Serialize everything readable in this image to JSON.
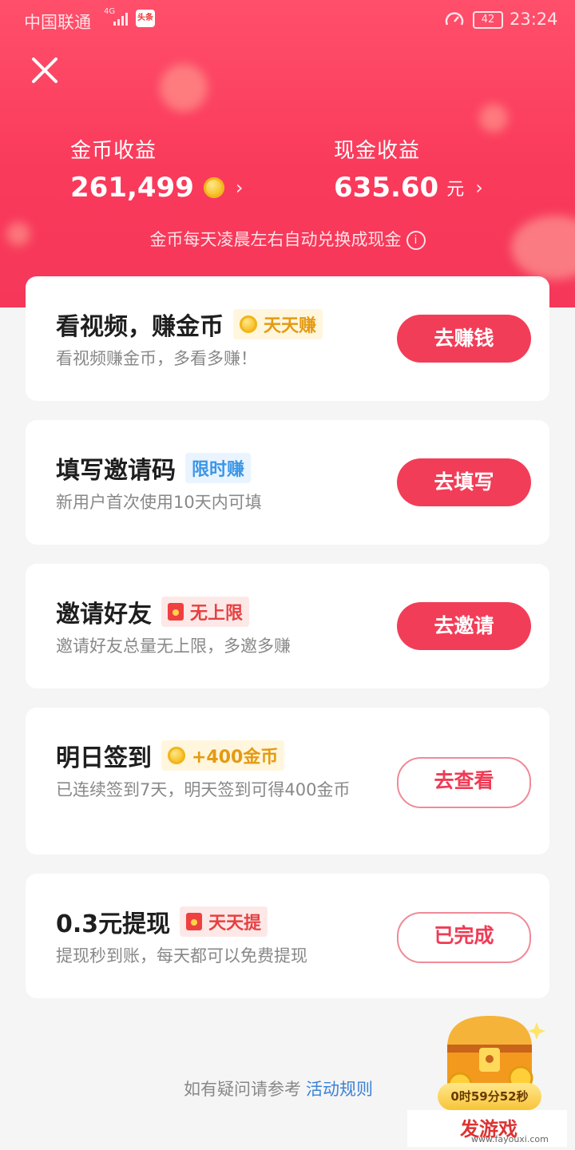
{
  "status_bar": {
    "carrier": "中国联通",
    "network": "4G",
    "battery": "42",
    "time": "23:24",
    "news_app_icon": "头条"
  },
  "header": {
    "coin_label": "金币收益",
    "coin_value": "261,499",
    "cash_label": "现金收益",
    "cash_value": "635.60",
    "cash_unit": "元",
    "chevron": "›",
    "note": "金币每天凌晨左右自动兑换成现金",
    "info": "i",
    "close_icon": "close-icon"
  },
  "tasks": [
    {
      "title": "看视频，赚金币",
      "tag": "天天赚",
      "tag_icon": "coin-icon",
      "desc": "看视频赚金币，多看多赚！",
      "button": "去赚钱",
      "button_style": "solid"
    },
    {
      "title": "填写邀请码",
      "tag": "限时赚",
      "tag_icon": "",
      "desc": "新用户首次使用10天内可填",
      "button": "去填写",
      "button_style": "solid"
    },
    {
      "title": "邀请好友",
      "tag": "无上限",
      "tag_icon": "red-envelope-icon",
      "desc": "邀请好友总量无上限，多邀多赚",
      "button": "去邀请",
      "button_style": "solid"
    },
    {
      "title": "明日签到",
      "tag": "+400金币",
      "tag_icon": "coin-icon",
      "desc": "已连续签到7天，明天签到可得400金币",
      "button": "去查看",
      "button_style": "outline"
    },
    {
      "title": "0.3元提现",
      "tag": "天天提",
      "tag_icon": "red-envelope-icon",
      "desc": "提现秒到账，每天都可以免费提现",
      "button": "已完成",
      "button_style": "outline"
    }
  ],
  "footer": {
    "text": "如有疑问请参考",
    "link": "活动规则"
  },
  "treasure": {
    "timer": "0时59分52秒",
    "icon": "treasure-chest-icon"
  },
  "watermark": {
    "brand": "发游戏",
    "url": "www.fayouxi.com"
  },
  "colors": {
    "header_red": "#f5375a",
    "button_red": "#f23d58",
    "tag_gold": "#e49a12",
    "tag_blue": "#3c96e6",
    "link_blue": "#3b82d6"
  }
}
